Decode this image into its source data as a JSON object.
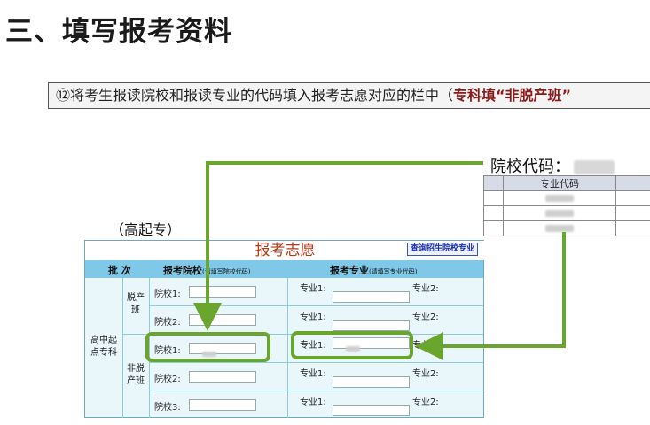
{
  "heading": "三、填写报考资料",
  "instruction": {
    "prefix": "⑫将考生报读院校和报读专业的代码填入报考志愿对应的栏中（",
    "highlight": "专科填“非脱产班”"
  },
  "code_panel": {
    "title": "院校代码：",
    "col_header": "专业代码"
  },
  "subtitle": "（高起专）",
  "form": {
    "title": "报考志愿",
    "query_button": "查询招生院校专业",
    "col_batch": "批 次",
    "col_school": "报考院校",
    "col_school_hint": "(请填写院校代码)",
    "col_major": "报考专业",
    "col_major_hint": "(请填写专业代码)",
    "level": "高中起点专科",
    "group_full_time": "脱产班",
    "group_part_time": "非脱产班",
    "rows": [
      {
        "school_label": "院校1:",
        "major1_label": "专业1:",
        "major2_label": "专业2:"
      },
      {
        "school_label": "院校2:",
        "major1_label": "专业1:",
        "major2_label": "专业2:"
      },
      {
        "school_label": "院校1:",
        "major1_label": "专业1:",
        "major2_label": "专业2:"
      },
      {
        "school_label": "院校2:",
        "major1_label": "专业1:",
        "major2_label": "专业2:"
      },
      {
        "school_label": "院校3:",
        "major1_label": "专业1:",
        "major2_label": "专业2:"
      }
    ]
  },
  "colors": {
    "arrow": "#6aa52e",
    "title_red": "#b33a1a",
    "header_blue": "#7fc8e8"
  }
}
